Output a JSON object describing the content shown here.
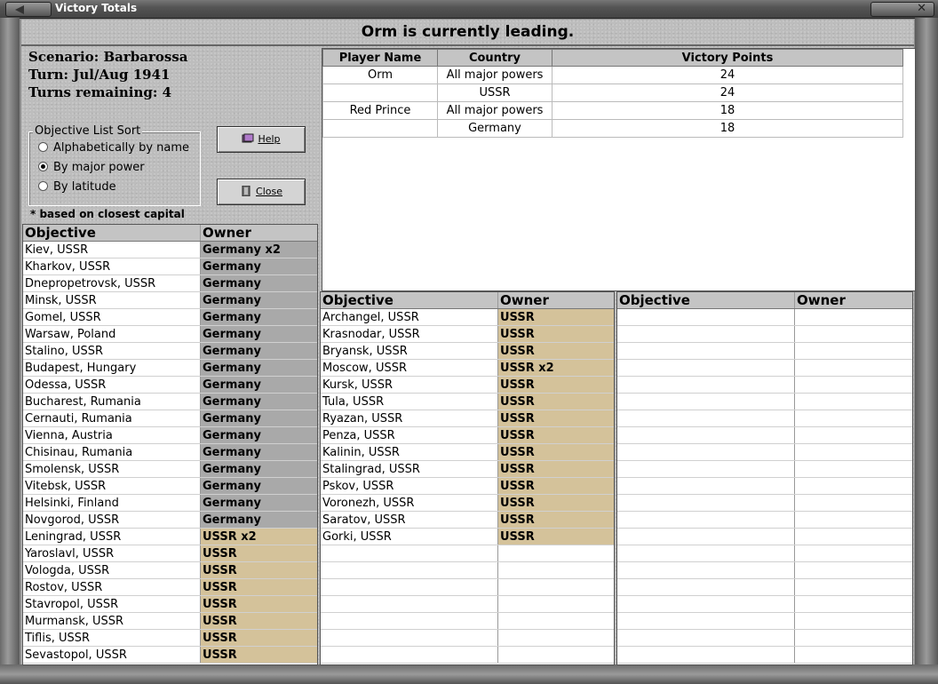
{
  "window": {
    "title": "Victory Totals"
  },
  "header": {
    "leading_text": "Orm is currently leading."
  },
  "info": {
    "scenario": "Scenario: Barbarossa",
    "turn": "Turn: Jul/Aug 1941",
    "turns_remaining": "Turns remaining: 4"
  },
  "sort": {
    "legend": "Objective List Sort",
    "options": [
      "Alphabetically by name",
      "By major power",
      "By latitude"
    ],
    "selected": "By major power"
  },
  "buttons": {
    "help": "Help",
    "close": "Close"
  },
  "footnote": "* based on closest capital",
  "players": {
    "headers": [
      "Player Name",
      "Country",
      "Victory Points"
    ],
    "rows": [
      [
        "Orm",
        "All major powers",
        "24"
      ],
      [
        "",
        "USSR",
        "24"
      ],
      [
        "Red Prince",
        "All major powers",
        "18"
      ],
      [
        "",
        "Germany",
        "18"
      ]
    ]
  },
  "objectives_headers": {
    "objective": "Objective",
    "owner": "Owner"
  },
  "objectives_left": [
    [
      "Kiev, USSR",
      "Germany x2"
    ],
    [
      "Kharkov, USSR",
      "Germany"
    ],
    [
      "Dnepropetrovsk, USSR",
      "Germany"
    ],
    [
      "Minsk, USSR",
      "Germany"
    ],
    [
      "Gomel, USSR",
      "Germany"
    ],
    [
      "Warsaw, Poland",
      "Germany"
    ],
    [
      "Stalino, USSR",
      "Germany"
    ],
    [
      "Budapest, Hungary",
      "Germany"
    ],
    [
      "Odessa, USSR",
      "Germany"
    ],
    [
      "Bucharest, Rumania",
      "Germany"
    ],
    [
      "Cernauti, Rumania",
      "Germany"
    ],
    [
      "Vienna, Austria",
      "Germany"
    ],
    [
      "Chisinau, Rumania",
      "Germany"
    ],
    [
      "Smolensk, USSR",
      "Germany"
    ],
    [
      "Vitebsk, USSR",
      "Germany"
    ],
    [
      "Helsinki, Finland",
      "Germany"
    ],
    [
      "Novgorod, USSR",
      "Germany"
    ],
    [
      "Leningrad, USSR",
      "USSR x2"
    ],
    [
      "Yaroslavl, USSR",
      "USSR"
    ],
    [
      "Vologda, USSR",
      "USSR"
    ],
    [
      "Rostov, USSR",
      "USSR"
    ],
    [
      "Stavropol, USSR",
      "USSR"
    ],
    [
      "Murmansk, USSR",
      "USSR"
    ],
    [
      "Tiflis, USSR",
      "USSR"
    ],
    [
      "Sevastopol, USSR",
      "USSR"
    ]
  ],
  "objectives_middle": [
    [
      "Archangel, USSR",
      "USSR"
    ],
    [
      "Krasnodar, USSR",
      "USSR"
    ],
    [
      "Bryansk, USSR",
      "USSR"
    ],
    [
      "Moscow, USSR",
      "USSR x2"
    ],
    [
      "Kursk, USSR",
      "USSR"
    ],
    [
      "Tula, USSR",
      "USSR"
    ],
    [
      "Ryazan, USSR",
      "USSR"
    ],
    [
      "Penza, USSR",
      "USSR"
    ],
    [
      "Kalinin, USSR",
      "USSR"
    ],
    [
      "Stalingrad, USSR",
      "USSR"
    ],
    [
      "Pskov, USSR",
      "USSR"
    ],
    [
      "Voronezh, USSR",
      "USSR"
    ],
    [
      "Saratov, USSR",
      "USSR"
    ],
    [
      "Gorki, USSR",
      "USSR"
    ]
  ],
  "objectives_right": [],
  "colors": {
    "germany_owner_bg": "#a9a9a9",
    "ussr_owner_bg": "#d4c29a"
  }
}
